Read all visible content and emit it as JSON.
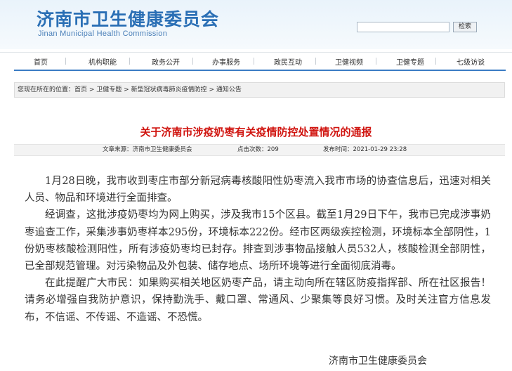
{
  "header": {
    "title": "济南市卫生健康委员会",
    "subtitle": "Jinan Municipal Health Commission",
    "search_placeholder": "",
    "search_button": "检索"
  },
  "nav": {
    "items": [
      "首页",
      "机构职能",
      "政务公开",
      "办事服务",
      "政民互动",
      "卫健视频",
      "卫健专题",
      "七级访谈"
    ]
  },
  "breadcrumb": {
    "prefix": "您现在所在的位置：",
    "items": [
      "首页",
      "卫健专题",
      "新型冠状病毒肺炎疫情防控",
      "通知公告"
    ],
    "separator": " > "
  },
  "article": {
    "title": "关于济南市涉疫奶枣有关疫情防控处置情况的通报",
    "meta": {
      "source_label": "文章来源：",
      "source": "济南市卫生健康委员会",
      "clicks_label": "点击次数：",
      "clicks": "209",
      "date_label": "发布时间：",
      "date": "2021-01-29 23:28"
    },
    "paragraphs": [
      "1月28日晚，我市收到枣庄市部分新冠病毒核酸阳性奶枣流入我市市场的协查信息后，迅速对相关人员、物品和环境进行全面排查。",
      "经调查，这批涉疫奶枣均为网上购买，涉及我市15个区县。截至1月29日下午，我市已完成涉事奶枣追查工作，采集涉事奶枣样本295份，环境标本222份。经市区两级疾控检测，环境标本全部阴性，1份奶枣核酸检测阳性，所有涉疫奶枣均已封存。排查到涉事物品接触人员532人，核酸检测全部阴性，已全部规范管理。对污染物品及外包装、储存地点、场所环境等进行全面彻底消毒。",
      "在此提醒广大市民：如果购买相关地区奶枣产品，请主动向所在辖区防疫指挥部、所在社区报告！请务必增强自我防护意识，保持勤洗手、戴口罩、常通风、少聚集等良好习惯。及时关注官方信息发布，不信谣、不传谣、不造谣、不恐慌。"
    ],
    "signature": "济南市卫生健康委员会"
  }
}
